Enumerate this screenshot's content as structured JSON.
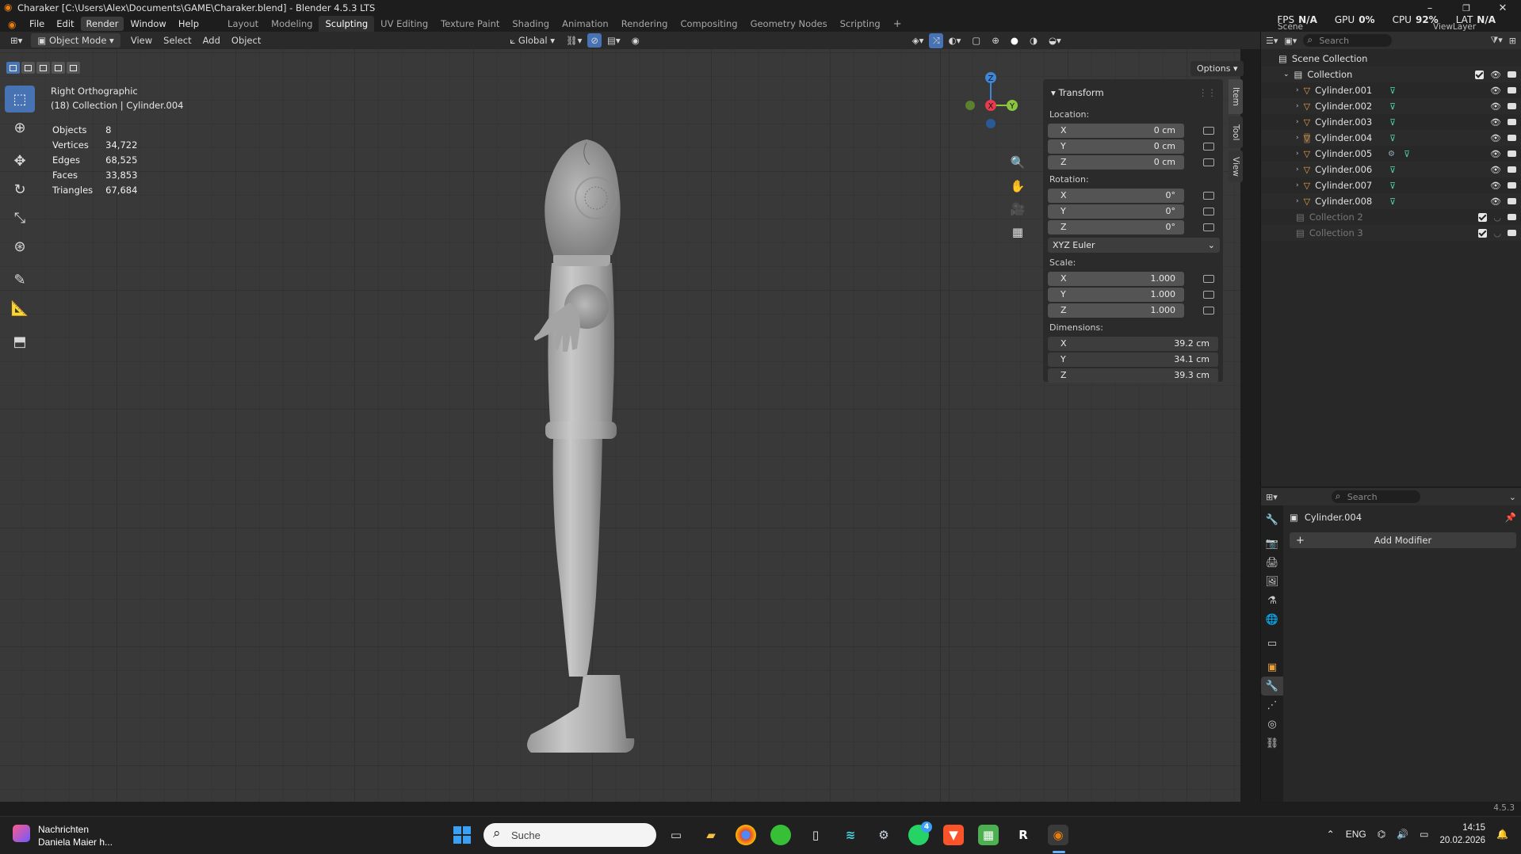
{
  "window": {
    "title": "Charaker [C:\\Users\\Alex\\Documents\\GAME\\Charaker.blend] - Blender 4.5.3 LTS",
    "minimize": "–",
    "maximize": "❐",
    "close": "✕"
  },
  "menu": {
    "file": "File",
    "edit": "Edit",
    "render": "Render",
    "window": "Window",
    "help": "Help"
  },
  "workspaces": [
    "Layout",
    "Modeling",
    "Sculpting",
    "UV Editing",
    "Texture Paint",
    "Shading",
    "Animation",
    "Rendering",
    "Compositing",
    "Geometry Nodes",
    "Scripting"
  ],
  "active_workspace": "Sculpting",
  "add_workspace": "+",
  "hud": {
    "fps_label": "FPS",
    "fps_value": "N/A",
    "gpu_label": "GPU",
    "gpu_value": "0%",
    "cpu_label": "CPU",
    "cpu_value": "92%",
    "lat_label": "LAT",
    "lat_value": "N/A",
    "scene": "Scene",
    "view_layer": "ViewLayer"
  },
  "viewport_header": {
    "mode": "Object Mode",
    "view": "View",
    "select": "Select",
    "add": "Add",
    "object": "Object",
    "orientation": "Global",
    "options": "Options"
  },
  "overlay": {
    "view_name": "Right Orthographic",
    "context": "(18) Collection | Cylinder.004"
  },
  "stats": [
    {
      "label": "Objects",
      "value": "8"
    },
    {
      "label": "Vertices",
      "value": "34,722"
    },
    {
      "label": "Edges",
      "value": "68,525"
    },
    {
      "label": "Faces",
      "value": "33,853"
    },
    {
      "label": "Triangles",
      "value": "67,684"
    }
  ],
  "gizmo": {
    "z": "Z",
    "x": "X",
    "y": "Y"
  },
  "npanel": {
    "title": "Transform",
    "location_label": "Location:",
    "location": [
      {
        "axis": "X",
        "value": "0 cm"
      },
      {
        "axis": "Y",
        "value": "0 cm"
      },
      {
        "axis": "Z",
        "value": "0 cm"
      }
    ],
    "rotation_label": "Rotation:",
    "rotation": [
      {
        "axis": "X",
        "value": "0°"
      },
      {
        "axis": "Y",
        "value": "0°"
      },
      {
        "axis": "Z",
        "value": "0°"
      }
    ],
    "rotation_mode": "XYZ Euler",
    "scale_label": "Scale:",
    "scale": [
      {
        "axis": "X",
        "value": "1.000"
      },
      {
        "axis": "Y",
        "value": "1.000"
      },
      {
        "axis": "Z",
        "value": "1.000"
      }
    ],
    "dimensions_label": "Dimensions:",
    "dimensions": [
      {
        "axis": "X",
        "value": "39.2 cm"
      },
      {
        "axis": "Y",
        "value": "34.1 cm"
      },
      {
        "axis": "Z",
        "value": "39.3 cm"
      }
    ],
    "tabs": [
      "Item",
      "Tool",
      "View"
    ]
  },
  "outliner": {
    "search_placeholder": "Search",
    "scene_collection": "Scene Collection",
    "collection": "Collection",
    "objects": [
      "Cylinder.001",
      "Cylinder.002",
      "Cylinder.003",
      "Cylinder.004",
      "Cylinder.005",
      "Cylinder.006",
      "Cylinder.007",
      "Cylinder.008"
    ],
    "selected_object": "Cylinder.004",
    "collection2": "Collection 2",
    "collection3": "Collection 3"
  },
  "properties": {
    "search_placeholder": "Search",
    "object_name": "Cylinder.004",
    "add_modifier": "Add Modifier",
    "add_icon": "+"
  },
  "status": {
    "version": "4.5.3"
  },
  "taskbar": {
    "notif_title": "Nachrichten",
    "notif_sub": "Daniela Maier h...",
    "search_placeholder": "Suche",
    "whatsapp_badge": "4",
    "lang": "ENG",
    "time": "14:15",
    "date": "20.02.2026"
  },
  "colors": {
    "accent": "#4772b3",
    "axis_x": "#e83b4d",
    "axis_y": "#8bc53f",
    "axis_z": "#3d86d8",
    "mesh_icon": "#e8a040",
    "data_icon": "#4fc9a4"
  }
}
